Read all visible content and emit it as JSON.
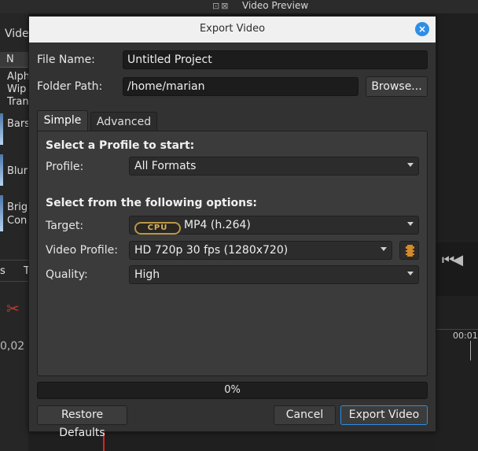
{
  "background": {
    "preview_title": "Video Preview",
    "window_buttons": "⊡⊠",
    "left_label": "Vide",
    "list_header": "N",
    "items": [
      "Alph",
      "Wip",
      "Tran",
      "Bars",
      "Blur",
      "Brig",
      "Con"
    ],
    "tab_a": "s",
    "tab_b": "T",
    "time_left": "0,02",
    "time_right": "00:01:",
    "transport": "⏮◀"
  },
  "dialog": {
    "title": "Export Video",
    "close_icon": "×",
    "file_name_label": "File Name:",
    "file_name_value": "Untitled Project",
    "folder_path_label": "Folder Path:",
    "folder_path_value": "/home/marian",
    "browse_label": "Browse...",
    "tabs": [
      {
        "label": "Simple",
        "active": true
      },
      {
        "label": "Advanced",
        "active": false
      }
    ],
    "profile_section": "Select a Profile to start:",
    "profile_label": "Profile:",
    "profile_value": "All Formats",
    "options_section": "Select from the following options:",
    "target_label": "Target:",
    "target_badge": "CPU",
    "target_value": "MP4 (h.264)",
    "video_profile_label": "Video Profile:",
    "video_profile_value": "HD 720p 30 fps (1280x720)",
    "quality_label": "Quality:",
    "quality_value": "High",
    "progress_value": 0,
    "progress_text": "0%",
    "restore_defaults_label": "Restore Defaults",
    "cancel_label": "Cancel",
    "export_label": "Export Video",
    "colors": {
      "accent": "#2d8ee6",
      "cpu_badge": "#b8964a",
      "playhead": "#e02020"
    }
  }
}
